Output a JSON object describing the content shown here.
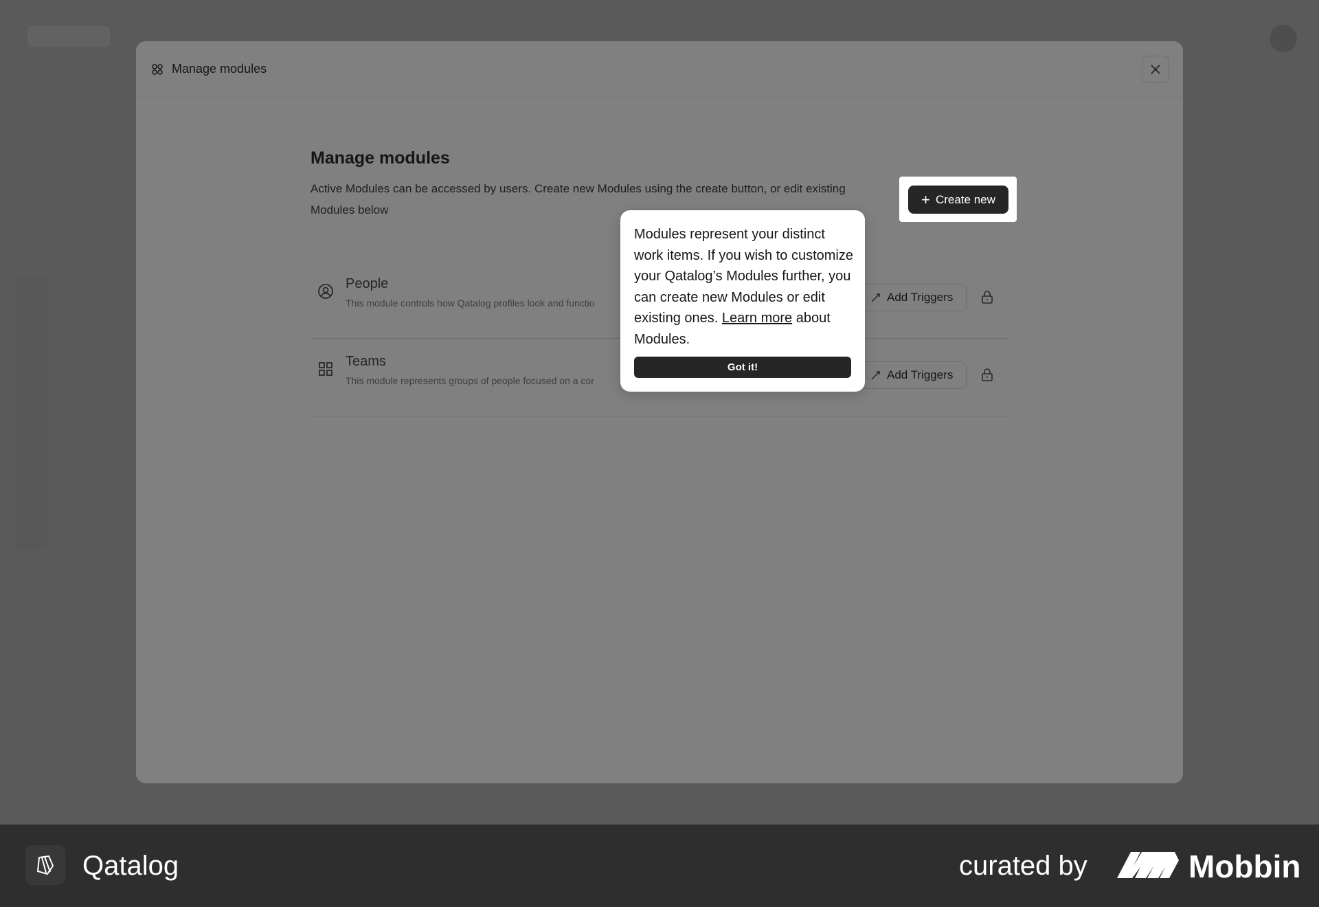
{
  "modal": {
    "header_title": "Manage modules",
    "title": "Manage modules",
    "description": "Active Modules can be accessed by users. Create new Modules using the create button, or edit existing Modules below",
    "create_button_label": "Create new"
  },
  "modules": [
    {
      "name": "People",
      "description": "This module controls how Qatalog profiles look and functio",
      "icon": "user-circle-icon",
      "trigger_label": "Add Triggers"
    },
    {
      "name": "Teams",
      "description": "This module represents groups of people focused on a cor",
      "icon": "grid-icon",
      "trigger_label": "Add Triggers"
    }
  ],
  "tooltip": {
    "text": "Modules represent your distinct work items. If you wish to customize your Qatalog’s Modules further, you can create new Modules or edit existing ones.",
    "link_text": "Learn more",
    "link_suffix": "about Modules.",
    "button_label": "Got it!"
  },
  "footer": {
    "app_name": "Qatalog",
    "curated_label": "curated by",
    "brand": "Mobbin"
  },
  "colors": {
    "overlay": "#5c5c5c",
    "modal": "#808080",
    "dark_button": "#262626",
    "footer": "#2e2e2e"
  }
}
